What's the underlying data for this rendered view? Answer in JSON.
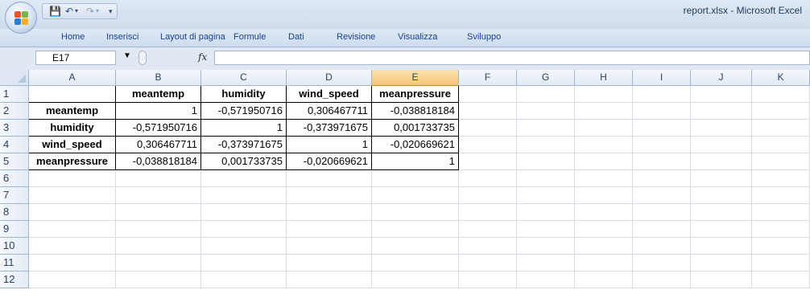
{
  "window": {
    "title": "report.xlsx - Microsoft Excel"
  },
  "qat": {
    "save_icon": "save-icon",
    "undo_icon": "undo-icon",
    "redo_icon": "redo-icon",
    "customize_icon": "customize-qat-icon"
  },
  "ribbon": {
    "tabs": [
      "Home",
      "Inserisci",
      "Layout di pagina",
      "Formule",
      "Dati",
      "Revisione",
      "Visualizza",
      "Sviluppo"
    ]
  },
  "formula_bar": {
    "name_box": "E17",
    "fx_label": "fx",
    "value": ""
  },
  "columns": [
    "A",
    "B",
    "C",
    "D",
    "E",
    "F",
    "G",
    "H",
    "I",
    "J",
    "K"
  ],
  "active_column": "E",
  "rows": [
    "1",
    "2",
    "3",
    "4",
    "5",
    "6",
    "7",
    "8",
    "9",
    "10",
    "11",
    "12"
  ],
  "sheet": {
    "header": [
      "",
      "meantemp",
      "humidity",
      "wind_speed",
      "meanpressure"
    ],
    "data": [
      [
        "meantemp",
        "1",
        "-0,571950716",
        "0,306467711",
        "-0,038818184"
      ],
      [
        "humidity",
        "-0,571950716",
        "1",
        "-0,373971675",
        "0,001733735"
      ],
      [
        "wind_speed",
        "0,306467711",
        "-0,373971675",
        "1",
        "-0,020669621"
      ],
      [
        "meanpressure",
        "-0,038818184",
        "0,001733735",
        "-0,020669621",
        "1"
      ]
    ]
  }
}
